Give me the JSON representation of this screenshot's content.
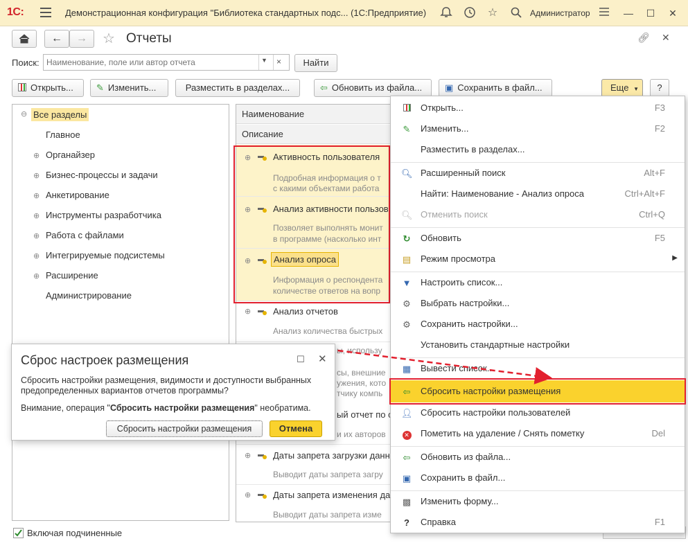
{
  "titlebar": {
    "logo": "1С:",
    "title": "Демонстрационная конфигурация \"Библиотека стандартных подс...  (1С:Предприятие)",
    "user": "Администратор"
  },
  "form": {
    "title": "Отчеты"
  },
  "search": {
    "label": "Поиск:",
    "placeholder": "Наименование, поле или автор отчета",
    "find_label": "Найти"
  },
  "toolbar": {
    "open": "Открыть...",
    "edit": "Изменить...",
    "place": "Разместить в разделах...",
    "update_from_file": "Обновить из файла...",
    "save_to_file": "Сохранить в файл...",
    "more": "Еще",
    "help": "?"
  },
  "tree": {
    "items": [
      {
        "label": "Все разделы",
        "expand": "⊖"
      },
      {
        "label": "Главное",
        "expand": ""
      },
      {
        "label": "Органайзер",
        "expand": "⊕"
      },
      {
        "label": "Бизнес-процессы и задачи",
        "expand": "⊕"
      },
      {
        "label": "Анкетирование",
        "expand": "⊕"
      },
      {
        "label": "Инструменты разработчика",
        "expand": "⊕"
      },
      {
        "label": "Работа с файлами",
        "expand": "⊕"
      },
      {
        "label": "Интегрируемые подсистемы",
        "expand": "⊕"
      },
      {
        "label": "Расширение",
        "expand": "⊕"
      },
      {
        "label": "Администрирование",
        "expand": ""
      }
    ],
    "include_subordinate": "Включая подчиненные"
  },
  "list": {
    "col_name": "Наименование",
    "col_desc": "Описание",
    "rows": [
      {
        "name": "Активность пользователя",
        "desc1": "Подробная информация о т",
        "desc2": "с какими объектами работа"
      },
      {
        "name": "Анализ активности пользов",
        "desc1": "Позволяет выполнять монит",
        "desc2": "в программе (насколько инт"
      },
      {
        "name": "Анализ опроса",
        "desc1": "Информация о респондента",
        "desc2": "количестве ответов на вопр"
      },
      {
        "name": "Анализ отчетов",
        "desc1": "Анализ количества быстрых",
        "desc2": ""
      },
      {
        "name": "",
        "desc1": "ы, использу",
        "desc2": ""
      },
      {
        "name": "",
        "desc1": "сы, внешние",
        "desc2": "ужения, кото"
      },
      {
        "name": "",
        "desc1": "тчику компь",
        "desc2": ""
      },
      {
        "name": "ый отчет по с",
        "desc1": "и их авторов",
        "desc2": ""
      },
      {
        "name": "Даты запрета загрузки данн",
        "desc1": "Выводит даты запрета загру",
        "desc2": ""
      },
      {
        "name": "Даты запрета изменения да",
        "desc1": "Выводит даты запрета изме",
        "desc2": ""
      }
    ]
  },
  "menu": {
    "items": [
      {
        "label": "Открыть...",
        "key": "F3",
        "icon": "report-icon"
      },
      {
        "label": "Изменить...",
        "key": "F2",
        "icon": "pencil-icon"
      },
      {
        "label": "Разместить в разделах...",
        "key": "",
        "icon": ""
      },
      {
        "label": "Расширенный поиск",
        "key": "Alt+F",
        "icon": "search-icon"
      },
      {
        "label": "Найти: Наименование - Анализ опроса",
        "key": "Ctrl+Alt+F",
        "icon": ""
      },
      {
        "label": "Отменить поиск",
        "key": "Ctrl+Q",
        "icon": "cancel-search-icon"
      },
      {
        "label": "Обновить",
        "key": "F5",
        "icon": "refresh-icon"
      },
      {
        "label": "Режим просмотра",
        "key": "",
        "icon": "view-mode-icon"
      },
      {
        "label": "Настроить список...",
        "key": "",
        "icon": "filter-icon"
      },
      {
        "label": "Выбрать настройки...",
        "key": "",
        "icon": "settings-select-icon"
      },
      {
        "label": "Сохранить настройки...",
        "key": "",
        "icon": "settings-save-icon"
      },
      {
        "label": "Установить стандартные настройки",
        "key": "",
        "icon": ""
      },
      {
        "label": "Вывести список...",
        "key": "",
        "icon": "print-list-icon"
      },
      {
        "label": "Сбросить настройки размещения",
        "key": "",
        "icon": "reset-placement-icon"
      },
      {
        "label": "Сбросить настройки пользователей",
        "key": "",
        "icon": "user-icon"
      },
      {
        "label": "Пометить на удаление / Снять пометку",
        "key": "Del",
        "icon": "delete-mark-icon"
      },
      {
        "label": "Обновить из файла...",
        "key": "",
        "icon": "update-file-icon"
      },
      {
        "label": "Сохранить в файл...",
        "key": "",
        "icon": "save-file-icon"
      },
      {
        "label": "Изменить форму...",
        "key": "",
        "icon": "form-icon"
      },
      {
        "label": "Справка",
        "key": "F1",
        "icon": "help-icon"
      }
    ],
    "submenu_arrow": "▶"
  },
  "dialog": {
    "title": "Сброс настроек размещения",
    "text": "Сбросить настройки размещения, видимости и доступности выбранных предопределенных вариантов отчетов программы?",
    "warn_prefix": "Внимание, операция \"",
    "warn_bold": "Сбросить настройки размещения",
    "warn_suffix": "\" необратима.",
    "confirm_label": "Сбросить настройки размещения",
    "cancel_label": "Отмена"
  },
  "colors": {
    "titlebar_bg": "#fbf0c9",
    "accent_yellow": "#fad22d",
    "highlight_red": "#e2202e",
    "row_selected": "#fdf3c9"
  }
}
